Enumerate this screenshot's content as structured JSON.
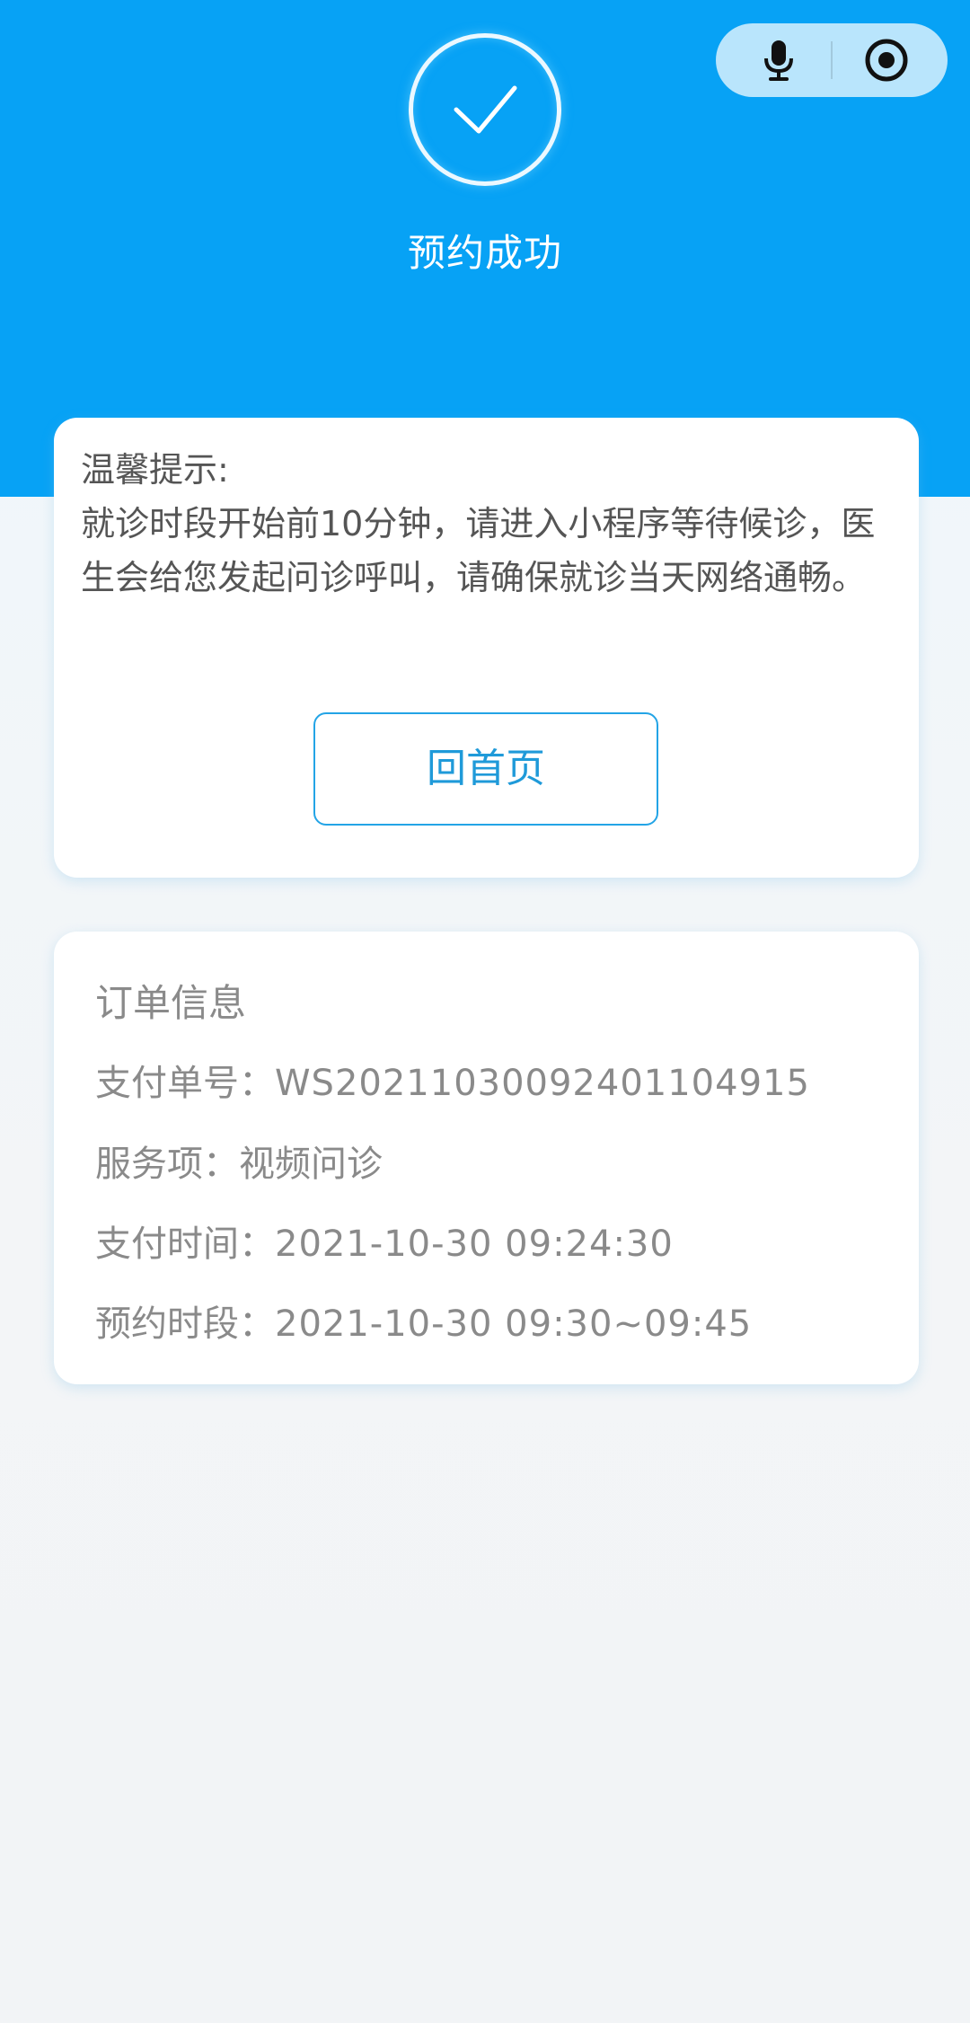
{
  "header": {
    "status_title": "预约成功",
    "success_icon": "check-circle-icon",
    "capsule": {
      "left_icon": "microphone-icon",
      "right_icon": "target-icon"
    },
    "background_color": "#07a2f5"
  },
  "tip_card": {
    "title": "温馨提示:",
    "message": "就诊时段开始前10分钟，请进入小程序等待候诊，医生会给您发起问诊呼叫，请确保就诊当天网络通畅。",
    "home_button_label": "回首页"
  },
  "order_card": {
    "title": "订单信息",
    "rows": [
      {
        "label": "支付单号：",
        "value": "WS20211030092401104915"
      },
      {
        "label": "服务项：",
        "value": "视频问诊"
      },
      {
        "label": "支付时间：",
        "value": "2021-10-30 09:24:30"
      },
      {
        "label": "预约时段：",
        "value": "2021-10-30 09:30~09:45"
      }
    ]
  },
  "colors": {
    "accent": "#07a2f5",
    "button_border": "#23a4e6",
    "text_secondary": "#8a8a8a"
  }
}
